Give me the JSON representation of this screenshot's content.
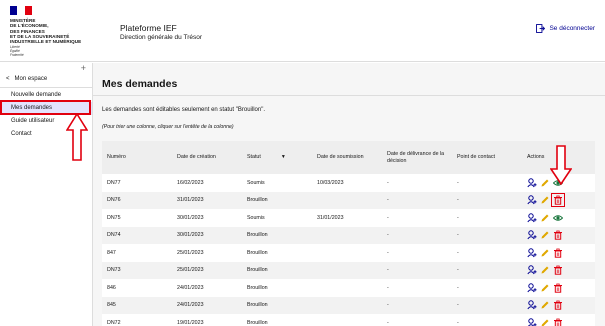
{
  "header": {
    "flag_colors": [
      "#000091",
      "#ffffff",
      "#e1000f"
    ],
    "ministry_lines": [
      "MINISTÈRE",
      "DE L'ÉCONOMIE,",
      "DES FINANCES",
      "ET DE LA SOUVERAINETÉ",
      "INDUSTRIELLE ET NUMÉRIQUE"
    ],
    "motto_lines": [
      "Liberté",
      "Égalité",
      "Fraternité"
    ],
    "platform_title": "Plateforme IEF",
    "platform_subtitle": "Direction générale du Trésor",
    "logout_label": "Se déconnecter",
    "logout_icon": "logout-icon"
  },
  "sidebar": {
    "collapse_icon": "+",
    "back_label": "Mon espace",
    "items": [
      {
        "label": "Nouvelle demande",
        "active": false
      },
      {
        "label": "Mes demandes",
        "active": true
      },
      {
        "label": "Guide utilisateur",
        "active": false
      },
      {
        "label": "Contact",
        "active": false
      }
    ]
  },
  "main": {
    "title": "Mes demandes",
    "notice": "Les demandes sont éditables seulement en statut \"Brouillon\".",
    "hint": "(Pour trier une colonne, cliquer sur l'entête de la colonne)",
    "columns": [
      "Numéro",
      "Date de création",
      "Statut",
      "Date de soumission",
      "Date de délivrance de la décision",
      "Point de contact",
      "Actions"
    ],
    "rows": [
      {
        "numero": "DN77",
        "creation": "16/02/2023",
        "statut": "Soumis",
        "soumission": "10/03/2023",
        "delivrance": "-",
        "contact": "-",
        "actions": [
          "assign",
          "edit",
          "view"
        ]
      },
      {
        "numero": "DN76",
        "creation": "31/01/2023",
        "statut": "Brouillon",
        "soumission": "",
        "delivrance": "-",
        "contact": "-",
        "actions": [
          "assign",
          "edit",
          "delete"
        ]
      },
      {
        "numero": "DN75",
        "creation": "30/01/2023",
        "statut": "Soumis",
        "soumission": "31/01/2023",
        "delivrance": "-",
        "contact": "-",
        "actions": [
          "assign",
          "edit",
          "view"
        ]
      },
      {
        "numero": "DN74",
        "creation": "30/01/2023",
        "statut": "Brouillon",
        "soumission": "",
        "delivrance": "-",
        "contact": "-",
        "actions": [
          "assign",
          "edit",
          "delete"
        ]
      },
      {
        "numero": "847",
        "creation": "25/01/2023",
        "statut": "Brouillon",
        "soumission": "",
        "delivrance": "-",
        "contact": "-",
        "actions": [
          "assign",
          "edit",
          "delete"
        ]
      },
      {
        "numero": "DN73",
        "creation": "25/01/2023",
        "statut": "Brouillon",
        "soumission": "",
        "delivrance": "-",
        "contact": "-",
        "actions": [
          "assign",
          "edit",
          "delete"
        ]
      },
      {
        "numero": "846",
        "creation": "24/01/2023",
        "statut": "Brouillon",
        "soumission": "",
        "delivrance": "-",
        "contact": "-",
        "actions": [
          "assign",
          "edit",
          "delete"
        ]
      },
      {
        "numero": "845",
        "creation": "24/01/2023",
        "statut": "Brouillon",
        "soumission": "",
        "delivrance": "-",
        "contact": "-",
        "actions": [
          "assign",
          "edit",
          "delete"
        ]
      },
      {
        "numero": "DN72",
        "creation": "19/01/2023",
        "statut": "Brouillon",
        "soumission": "",
        "delivrance": "-",
        "contact": "-",
        "actions": [
          "assign",
          "edit",
          "delete"
        ]
      }
    ]
  },
  "colors": {
    "primary": "#000091",
    "danger": "#e1000f",
    "view": "#18753c",
    "edit": "#e0a800",
    "active_bg": "#e3e3fd"
  }
}
